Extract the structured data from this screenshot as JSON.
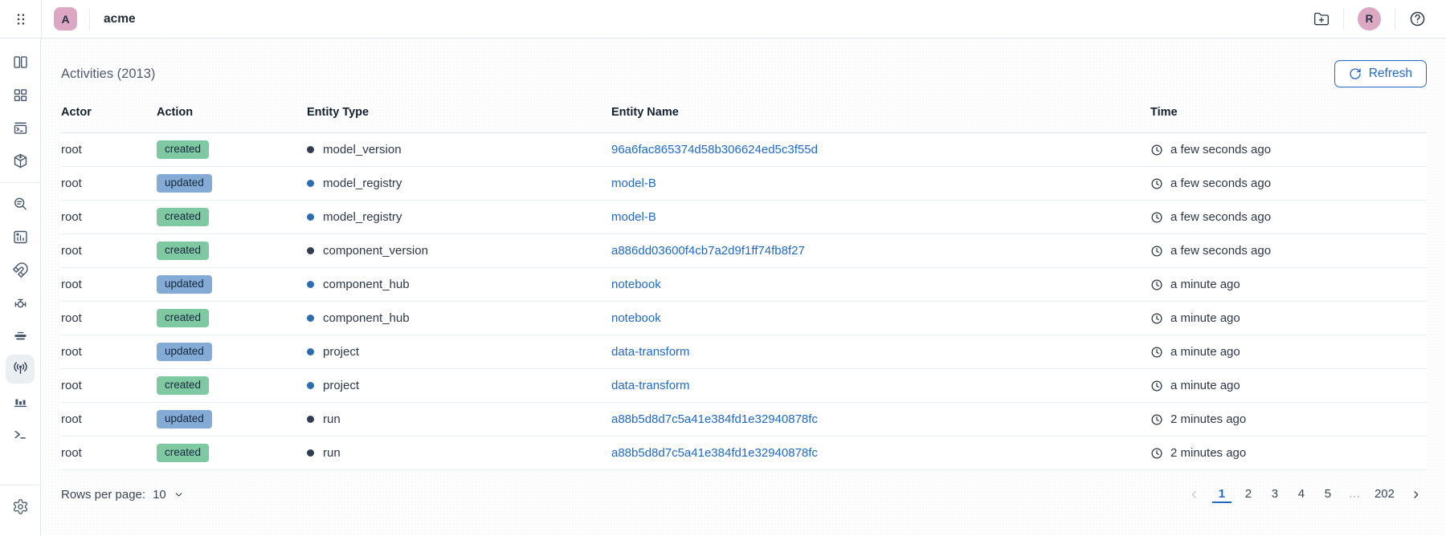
{
  "topbar": {
    "org_avatar_initial": "A",
    "org_name": "acme",
    "user_avatar_initial": "R"
  },
  "sidebar": {
    "icons": [
      "panels",
      "dashboard",
      "console-window",
      "package",
      "search-insights",
      "chart-board",
      "magnet",
      "pipeline",
      "stream-layers",
      "broadcast",
      "bar-columns",
      "terminal",
      "settings"
    ],
    "active_icon": "broadcast"
  },
  "page": {
    "title": "Activities (2013)",
    "refresh_label": "Refresh"
  },
  "table": {
    "columns": [
      "Actor",
      "Action",
      "Entity Type",
      "Entity Name",
      "Time"
    ],
    "rows": [
      {
        "actor": "root",
        "action": "created",
        "entity_type": "model_version",
        "dot": "dark",
        "entity_name": "96a6fac865374d58b306624ed5c3f55d",
        "time": "a few seconds ago"
      },
      {
        "actor": "root",
        "action": "updated",
        "entity_type": "model_registry",
        "dot": "blue",
        "entity_name": "model-B",
        "time": "a few seconds ago"
      },
      {
        "actor": "root",
        "action": "created",
        "entity_type": "model_registry",
        "dot": "blue",
        "entity_name": "model-B",
        "time": "a few seconds ago"
      },
      {
        "actor": "root",
        "action": "created",
        "entity_type": "component_version",
        "dot": "dark",
        "entity_name": "a886dd03600f4cb7a2d9f1ff74fb8f27",
        "time": "a few seconds ago"
      },
      {
        "actor": "root",
        "action": "updated",
        "entity_type": "component_hub",
        "dot": "blue",
        "entity_name": "notebook",
        "time": "a minute ago"
      },
      {
        "actor": "root",
        "action": "created",
        "entity_type": "component_hub",
        "dot": "blue",
        "entity_name": "notebook",
        "time": "a minute ago"
      },
      {
        "actor": "root",
        "action": "updated",
        "entity_type": "project",
        "dot": "blue",
        "entity_name": "data-transform",
        "time": "a minute ago"
      },
      {
        "actor": "root",
        "action": "created",
        "entity_type": "project",
        "dot": "blue",
        "entity_name": "data-transform",
        "time": "a minute ago"
      },
      {
        "actor": "root",
        "action": "updated",
        "entity_type": "run",
        "dot": "dark",
        "entity_name": "a88b5d8d7c5a41e384fd1e32940878fc",
        "time": "2 minutes ago"
      },
      {
        "actor": "root",
        "action": "created",
        "entity_type": "run",
        "dot": "dark",
        "entity_name": "a88b5d8d7c5a41e384fd1e32940878fc",
        "time": "2 minutes ago"
      }
    ]
  },
  "footer": {
    "rows_per_page_label": "Rows per page:",
    "rows_per_page_value": "10",
    "pages": [
      "1",
      "2",
      "3",
      "4",
      "5",
      "…",
      "202"
    ],
    "current_page": "1"
  },
  "colors": {
    "accent_blue": "#2169c8",
    "badge_created": "#7ec9a2",
    "badge_updated": "#84abd5",
    "dot_dark": "#2e3d51",
    "dot_blue": "#2b6cb5",
    "avatar_pink": "#dba7c3",
    "active_item_bg": "#eceff2"
  }
}
